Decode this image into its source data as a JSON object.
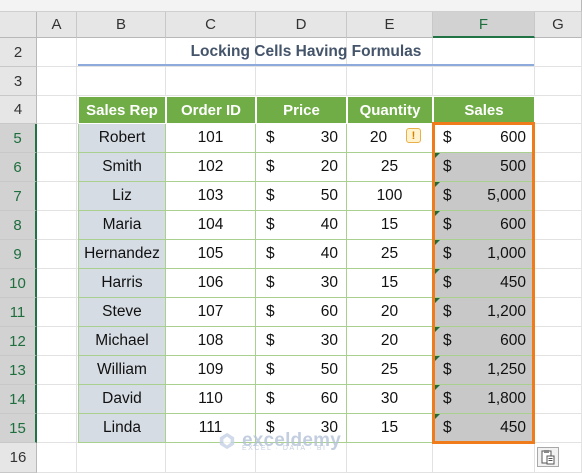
{
  "spreadsheet": {
    "columns": [
      "A",
      "B",
      "C",
      "D",
      "E",
      "F",
      "G"
    ],
    "rows": [
      2,
      3,
      4,
      5,
      6,
      7,
      8,
      9,
      10,
      11,
      12,
      13,
      14,
      15,
      16
    ],
    "title": "Locking Cells Having Formulas",
    "headers": [
      "Sales Rep",
      "Order ID",
      "Price",
      "Quantity",
      "Sales"
    ],
    "currency_symbol": "$",
    "records": [
      {
        "rep": "Robert",
        "id": "101",
        "price": "30",
        "qty": "20",
        "sales": "600"
      },
      {
        "rep": "Smith",
        "id": "102",
        "price": "20",
        "qty": "25",
        "sales": "500"
      },
      {
        "rep": "Liz",
        "id": "103",
        "price": "50",
        "qty": "100",
        "sales": "5,000"
      },
      {
        "rep": "Maria",
        "id": "104",
        "price": "40",
        "qty": "15",
        "sales": "600"
      },
      {
        "rep": "Hernandez",
        "id": "105",
        "price": "40",
        "qty": "25",
        "sales": "1,000"
      },
      {
        "rep": "Harris",
        "id": "106",
        "price": "30",
        "qty": "15",
        "sales": "450"
      },
      {
        "rep": "Steve",
        "id": "107",
        "price": "60",
        "qty": "20",
        "sales": "1,200"
      },
      {
        "rep": "Michael",
        "id": "108",
        "price": "30",
        "qty": "20",
        "sales": "600"
      },
      {
        "rep": "William",
        "id": "109",
        "price": "50",
        "qty": "25",
        "sales": "1,250"
      },
      {
        "rep": "David",
        "id": "110",
        "price": "60",
        "qty": "30",
        "sales": "1,800"
      },
      {
        "rep": "Linda",
        "id": "111",
        "price": "30",
        "qty": "15",
        "sales": "450"
      }
    ],
    "warning_glyph": "!"
  },
  "watermark": {
    "name": "exceldemy",
    "tagline": "EXCEL · DATA · BI"
  },
  "colors": {
    "header_fill": "#70ad47",
    "name_fill": "#d6dce4",
    "sales_fill": "#c8c8c8",
    "selection": "#f07b1b",
    "title": "#44546a"
  }
}
